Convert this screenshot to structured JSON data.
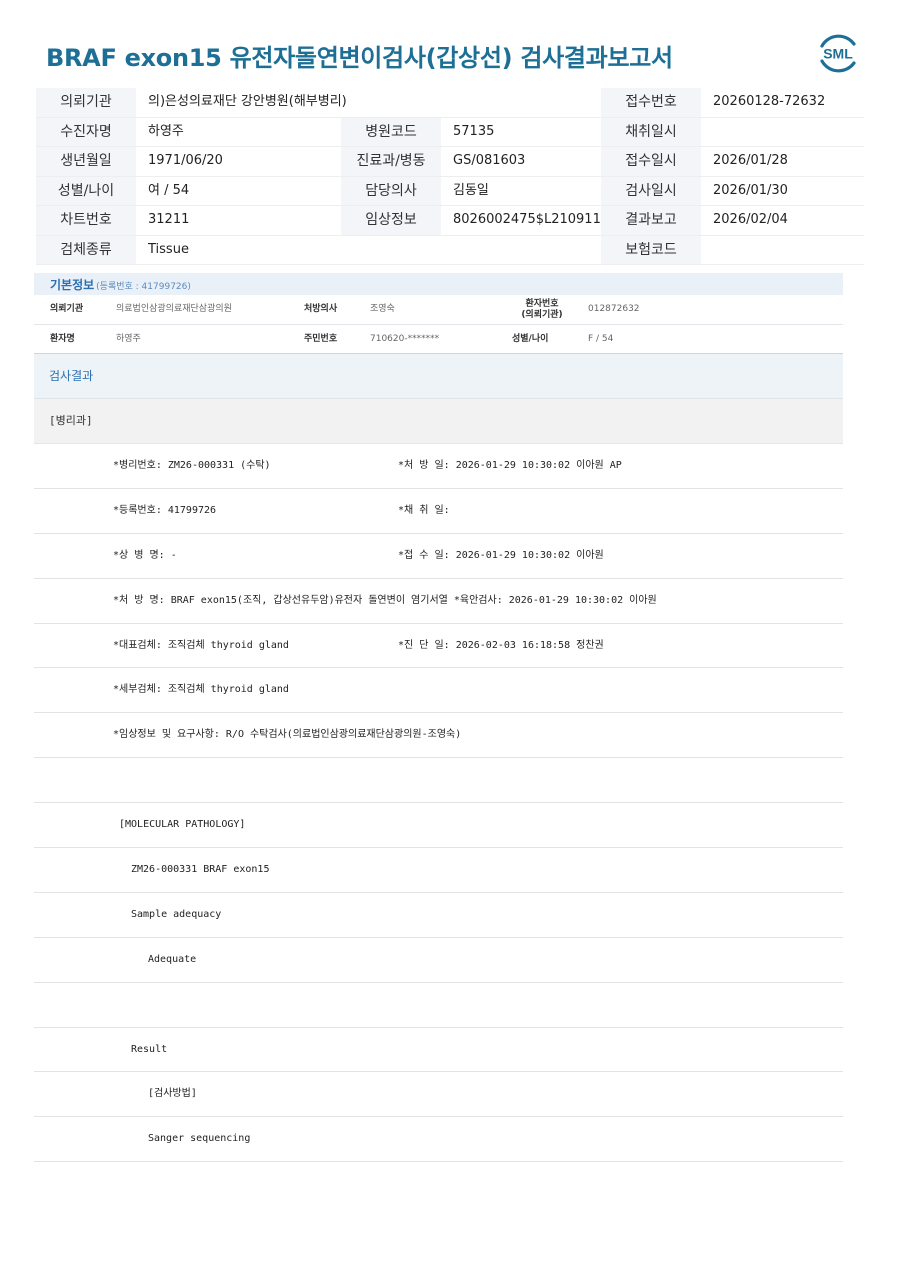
{
  "title": "BRAF exon15 유전자돌연변이검사(갑상선) 검사결과보고서",
  "logo_text": "SML",
  "brand_color": "#1e6f96",
  "header": {
    "institution_label": "의뢰기관",
    "institution_value": "의)은성의료재단 강안병원(해부병리)",
    "receipt_no_label": "접수번호",
    "receipt_no_value": "20260128-72632",
    "examinee_label": "수진자명",
    "examinee_value": "하영주",
    "hospital_code_label": "병원코드",
    "hospital_code_value": "57135",
    "collection_date_label": "채취일시",
    "collection_date_value": "",
    "birth_label": "생년월일",
    "birth_value": "1971/06/20",
    "dept_label": "진료과/병동",
    "dept_value": "GS/081603",
    "received_date_label": "접수일시",
    "received_date_value": "2026/01/28",
    "sex_age_label": "성별/나이",
    "sex_age_value": "여 / 54",
    "doctor_label": "담당의사",
    "doctor_value": "김동일",
    "test_date_label": "검사일시",
    "test_date_value": "2026/01/30",
    "chart_no_label": "차트번호",
    "chart_no_value": "31211",
    "clinical_label": "임상정보",
    "clinical_value": "8026002475$L210911",
    "report_date_label": "결과보고",
    "report_date_value": "2026/02/04",
    "specimen_label": "검체종류",
    "specimen_value": "Tissue",
    "insurance_label": "보험코드",
    "insurance_value": ""
  },
  "basic_info": {
    "heading": "기본정보",
    "reg_no": "(등록번호 : 41799726)",
    "institution_label": "의뢰기관",
    "institution_value": "의료법인삼광의료재단삼광의원",
    "prescriber_label": "처방의사",
    "prescriber_value": "조영숙",
    "patient_no_label_1": "환자번호",
    "patient_no_label_2": "(의뢰기관)",
    "patient_no_value": "012872632",
    "patient_name_label": "환자명",
    "patient_name_value": "하영주",
    "rrn_label": "주민번호",
    "rrn_value": "710620-*******",
    "sex_age_label": "성별/나이",
    "sex_age_value": "F / 54"
  },
  "result_heading": "검사결과",
  "dept_heading": "[병리과]",
  "report_lines": [
    {
      "a": "*병리번호: ZM26-000331 (수탁)",
      "b": "*처 방 일: 2026-01-29 10:30:02  이아원 AP"
    },
    {
      "a": "*등록번호: 41799726",
      "b": "*채 취 일:"
    },
    {
      "a": "*상 병 명: -",
      "b": "*접 수 일: 2026-01-29 10:30:02  이아원"
    },
    {
      "a": "*처 방 명: BRAF exon15(조직, 갑상선유두암)유전자 돌연변이 염기서열  *육안검사: 2026-01-29 10:30:02  이아원",
      "b": ""
    },
    {
      "a": "*대표검체: 조직검체 thyroid gland",
      "b": "*진 단 일: 2026-02-03 16:18:58  정찬권"
    },
    {
      "a": "*세부검체: 조직검체 thyroid gland",
      "b": ""
    },
    {
      "a": "*임상정보 및 요구사항: R/O 수탁검사(의료법인삼광의료재단삼광의원-조영숙)",
      "b": ""
    },
    {
      "a": "",
      "b": ""
    },
    {
      "a": "[MOLECULAR PATHOLOGY]",
      "b": ""
    },
    {
      "a": "ZM26-000331     BRAF exon15",
      "b": ""
    },
    {
      "a": "Sample adequacy",
      "b": ""
    },
    {
      "a": "Adequate",
      "b": ""
    },
    {
      "a": "",
      "b": ""
    },
    {
      "a": "Result",
      "b": ""
    },
    {
      "a": "[검사방법]",
      "b": ""
    },
    {
      "a": "Sanger sequencing",
      "b": ""
    }
  ]
}
